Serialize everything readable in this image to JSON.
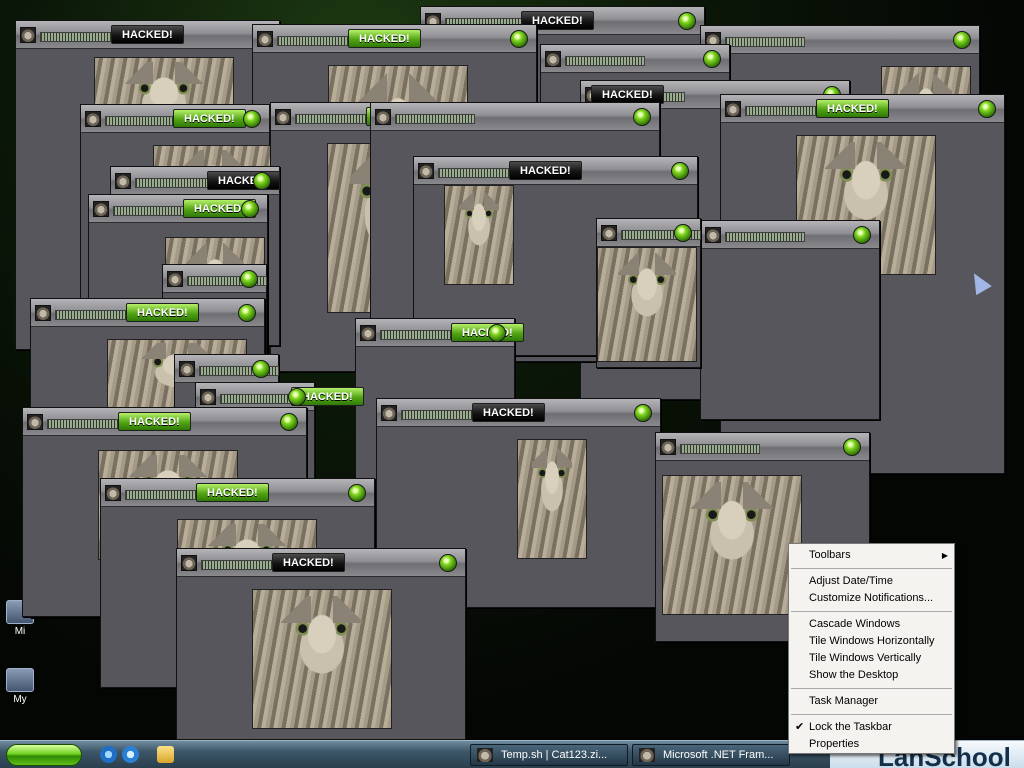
{
  "desktop": {
    "icons": [
      {
        "label": "Mi"
      },
      {
        "label": "My"
      }
    ]
  },
  "popup": {
    "label": "HACKED!"
  },
  "taskbar": {
    "tasks": [
      {
        "label": "Temp.sh | Cat123.zi..."
      },
      {
        "label": "Microsoft .NET Fram..."
      }
    ],
    "tray_banner": "LanSchool"
  },
  "context_menu": {
    "items": [
      {
        "label": "Toolbars",
        "submenu": true
      },
      {
        "label": "Adjust Date/Time"
      },
      {
        "label": "Customize Notifications..."
      },
      {
        "label": "Cascade Windows"
      },
      {
        "label": "Tile Windows Horizontally"
      },
      {
        "label": "Tile Windows Vertically"
      },
      {
        "label": "Show the Desktop"
      },
      {
        "label": "Task Manager"
      },
      {
        "label": "Lock the Taskbar",
        "checked": true
      },
      {
        "label": "Properties"
      }
    ]
  },
  "colors": {
    "label_green": "#53a514",
    "label_dark": "#141414",
    "window_body": "#56565c"
  }
}
